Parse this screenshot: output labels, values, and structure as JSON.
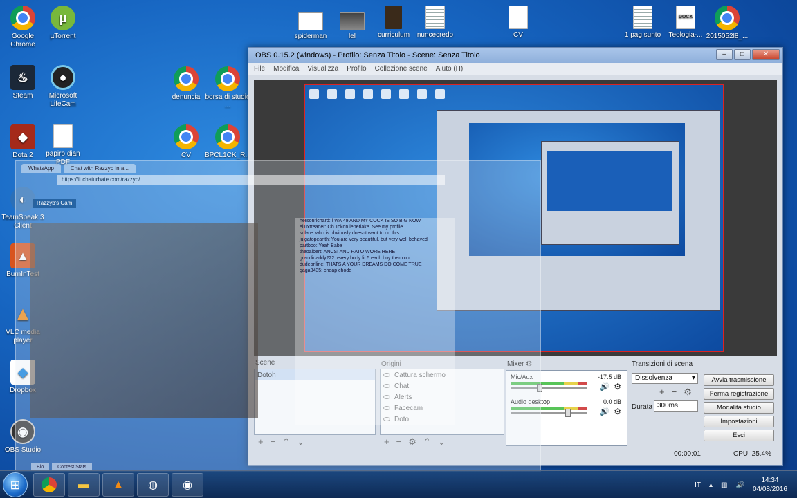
{
  "desktop_icons": [
    {
      "label": "Google Chrome",
      "icon": "chrome-icon"
    },
    {
      "label": "µTorrent",
      "icon": "utorrent-icon"
    },
    {
      "label": "Steam",
      "icon": "steam-icon"
    },
    {
      "label": "Microsoft LifeCam",
      "icon": "lifecam-icon"
    },
    {
      "label": "Dota 2",
      "icon": "dota2-icon"
    },
    {
      "label": "papiro dian PDF",
      "icon": "document-icon"
    },
    {
      "label": "spiderman",
      "icon": "image-icon"
    },
    {
      "label": "lel",
      "icon": "image-icon"
    },
    {
      "label": "curriculum",
      "icon": "image-icon"
    },
    {
      "label": "nuncecredo",
      "icon": "document-icon"
    },
    {
      "label": "CV",
      "icon": "document-icon"
    },
    {
      "label": "1 pag sunto",
      "icon": "document-icon"
    },
    {
      "label": "Teologia-...",
      "icon": "docx-icon"
    },
    {
      "label": "2015052l8_...",
      "icon": "chrome-icon"
    },
    {
      "label": "denuncia",
      "icon": "chrome-icon"
    },
    {
      "label": "borsa di studio ...",
      "icon": "chrome-icon"
    },
    {
      "label": "CV",
      "icon": "chrome-icon"
    },
    {
      "label": "BPCL1CK_R...",
      "icon": "chrome-icon"
    },
    {
      "label": "TeamSpeak 3 Client",
      "icon": "teamspeak-icon"
    },
    {
      "label": "BurnInTest",
      "icon": "burnintest-icon"
    },
    {
      "label": "VLC media player",
      "icon": "vlc-icon"
    },
    {
      "label": "Dropbox",
      "icon": "dropbox-icon"
    },
    {
      "label": "OBS Studio",
      "icon": "obs-icon"
    }
  ],
  "obs": {
    "title": "OBS 0.15.2 (windows) - Profilo: Senza Titolo - Scene: Senza Titolo",
    "menu": [
      "File",
      "Modifica",
      "Visualizza",
      "Profilo",
      "Collezione scene",
      "Aiuto (H)"
    ],
    "scene_label": "Scene",
    "scenes": [
      "Dotoh"
    ],
    "sources_label": "Origini",
    "sources": [
      "Cattura schermo",
      "Chat",
      "Alerts",
      "Facecam",
      "Doto"
    ],
    "mixer_label": "Mixer",
    "mixer": [
      {
        "name": "Mic/Aux",
        "db": "-17.5 dB",
        "level": 0.38
      },
      {
        "name": "Audio desktop",
        "db": "0.0 dB",
        "level": 0.75
      }
    ],
    "transitions_label": "Transizioni di scena",
    "transition_value": "Dissolvenza",
    "duration_label": "Durata",
    "duration_value": "300ms",
    "buttons": [
      "Avvia trasmissione",
      "Ferma registrazione",
      "Modalità studio",
      "Impostazioni",
      "Esci"
    ],
    "status_time": "00:00:01",
    "status_cpu": "CPU: 25.4%"
  },
  "browser": {
    "tabs": [
      "WhatsApp",
      "Chat with Razzyb in a..."
    ],
    "address": "https://it.chaturbate.com/razzyb/",
    "cam_title": "Razzyb's Cam",
    "chat_lines": [
      "hersonrichard: i WA 49 AND MY COCK IS SO BIG NOW",
      "elluxtreader: Oh Tokon lenerlake. See my profile.",
      "solare: who is obviously doesnt want to do this",
      "julgatopeanth: You are very beautiful, but very well behaved",
      "partboo: Yeah Babe",
      "theoalbert: ANCSI AND RATO WORE HERE",
      "grandidaddy222: every body lit 5 each buy them out",
      "dudeonline: THATS A YOUR DREAMS DO COME TRUE",
      "gaga3435: cheap chode"
    ],
    "footer_tabs": [
      "Bio",
      "Contest Stats"
    ]
  },
  "taskbar": {
    "apps": [
      "chrome-icon",
      "explorer-icon",
      "vlc-icon",
      "steam-icon",
      "obs-icon"
    ],
    "lang": "IT",
    "time": "14:34",
    "date": "04/08/2016"
  }
}
